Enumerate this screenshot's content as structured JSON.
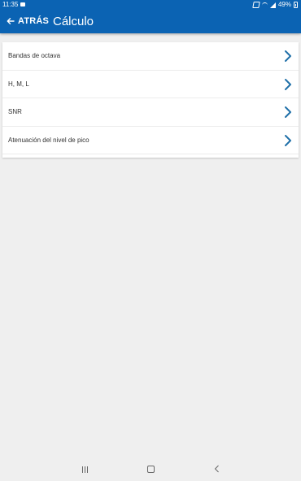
{
  "status_bar": {
    "time": "11:35",
    "battery": "49%",
    "icons": [
      "gallery-icon",
      "mute-icon",
      "wifi-icon",
      "signal-icon",
      "battery-icon"
    ]
  },
  "app_bar": {
    "back_label": "ATRÁS",
    "title": "Cálculo",
    "color": "#0b63b3"
  },
  "menu": {
    "items": [
      {
        "label": "Bandas de octava"
      },
      {
        "label": "H, M, L"
      },
      {
        "label": "SNR"
      },
      {
        "label": "Atenuación del nivel de pico"
      }
    ],
    "chevron_color": "#1f6fa8"
  },
  "nav_bar": {
    "icons": [
      "recents-icon",
      "home-icon",
      "back-icon"
    ]
  }
}
